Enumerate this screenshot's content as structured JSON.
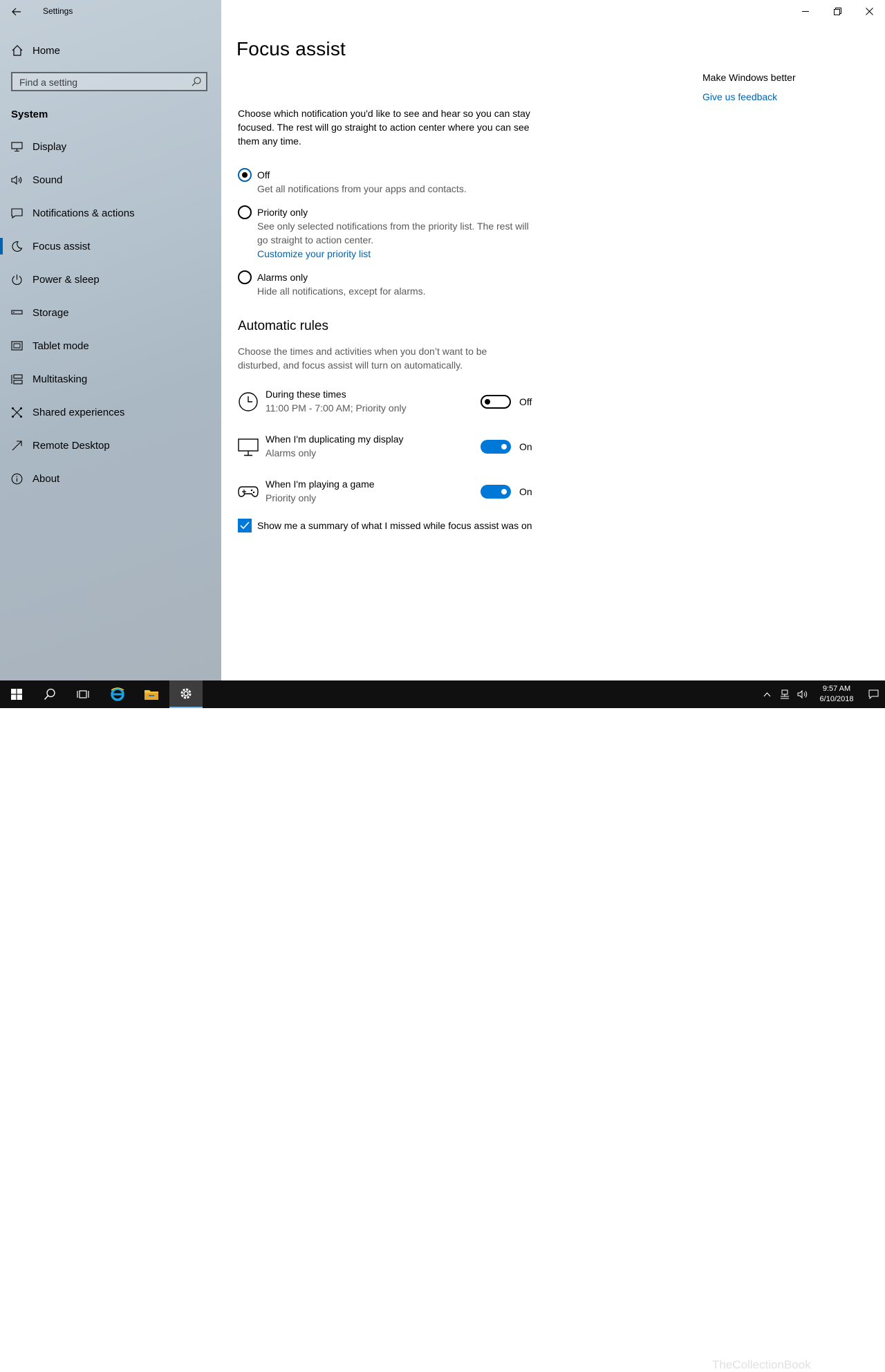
{
  "window": {
    "title": "Settings"
  },
  "sidebar": {
    "home_label": "Home",
    "search_placeholder": "Find a setting",
    "section": "System",
    "items": [
      {
        "label": "Display",
        "icon": "monitor-icon"
      },
      {
        "label": "Sound",
        "icon": "speaker-icon"
      },
      {
        "label": "Notifications & actions",
        "icon": "message-icon"
      },
      {
        "label": "Focus assist",
        "icon": "moon-icon",
        "active": true
      },
      {
        "label": "Power & sleep",
        "icon": "power-icon"
      },
      {
        "label": "Storage",
        "icon": "storage-icon"
      },
      {
        "label": "Tablet mode",
        "icon": "tablet-icon"
      },
      {
        "label": "Multitasking",
        "icon": "multitasking-icon"
      },
      {
        "label": "Shared experiences",
        "icon": "shared-icon"
      },
      {
        "label": "Remote Desktop",
        "icon": "remote-icon"
      },
      {
        "label": "About",
        "icon": "info-icon"
      }
    ]
  },
  "main": {
    "title": "Focus assist",
    "description": "Choose which notification you'd like to see and hear so you can stay focused. The rest will go straight to action center where you can see them any time.",
    "options": [
      {
        "label": "Off",
        "sub": "Get all notifications from your apps and contacts.",
        "checked": true
      },
      {
        "label": "Priority only",
        "sub": "See only selected notifications from the priority list. The rest will go straight to action center.",
        "link": "Customize your priority list"
      },
      {
        "label": "Alarms only",
        "sub": "Hide all notifications, except for alarms."
      }
    ],
    "auto_rules": {
      "heading": "Automatic rules",
      "description": "Choose the times and activities when you don’t want to be disturbed, and focus assist will turn on automatically.",
      "rules": [
        {
          "title": "During these times",
          "sub": "11:00 PM - 7:00 AM; Priority only",
          "state": "Off"
        },
        {
          "title": "When I'm duplicating my display",
          "sub": "Alarms only",
          "state": "On"
        },
        {
          "title": "When I'm playing a game",
          "sub": "Priority only",
          "state": "On"
        }
      ]
    },
    "summary_checkbox": "Show me a summary of what I missed while focus assist was on"
  },
  "aside": {
    "title": "Make Windows better",
    "link": "Give us feedback"
  },
  "taskbar": {
    "time": "9:57 AM",
    "date": "6/10/2018",
    "watermark": "TheCollectionBook"
  },
  "colors": {
    "accent": "#0078d7",
    "link": "#0063b1",
    "taskbar": "#101010"
  }
}
